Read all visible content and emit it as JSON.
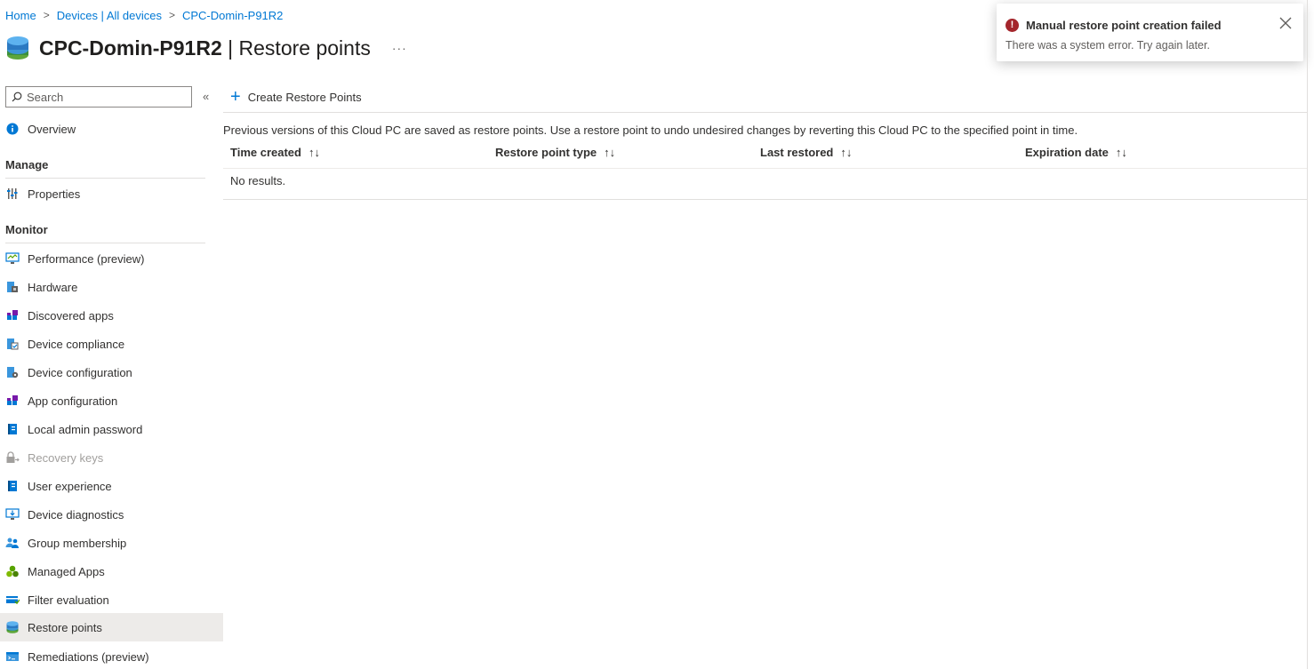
{
  "breadcrumb": [
    "Home",
    "Devices | All devices",
    "CPC-Domin-P91R2"
  ],
  "header": {
    "device": "CPC-Domin-P91R2",
    "separator": " | ",
    "page": "Restore points",
    "more": "···"
  },
  "toast": {
    "title": "Manual restore point creation failed",
    "message": "There was a system error. Try again later.",
    "status_color": "#a4262c"
  },
  "search": {
    "placeholder": "Search"
  },
  "collapse_glyph": "«",
  "sidebar": {
    "overview": "Overview",
    "manage_header": "Manage",
    "properties": "Properties",
    "monitor_header": "Monitor",
    "monitor_items": [
      "Performance (preview)",
      "Hardware",
      "Discovered apps",
      "Device compliance",
      "Device configuration",
      "App configuration",
      "Local admin password",
      "Recovery keys",
      "User experience",
      "Device diagnostics",
      "Group membership",
      "Managed Apps",
      "Filter evaluation",
      "Restore points",
      "Remediations (preview)"
    ],
    "selected": "Restore points",
    "disabled": "Recovery keys"
  },
  "toolbar": {
    "create_label": "Create Restore Points"
  },
  "main": {
    "description": "Previous versions of this Cloud PC are saved as restore points. Use a restore point to undo undesired changes by reverting this Cloud PC to the specified point in time.",
    "columns": [
      "Time created",
      "Restore point type",
      "Last restored",
      "Expiration date"
    ],
    "sort_glyph": "↑↓",
    "empty_text": "No results."
  },
  "colors": {
    "accent": "#0078d4",
    "selected_bg": "#edebe9"
  }
}
